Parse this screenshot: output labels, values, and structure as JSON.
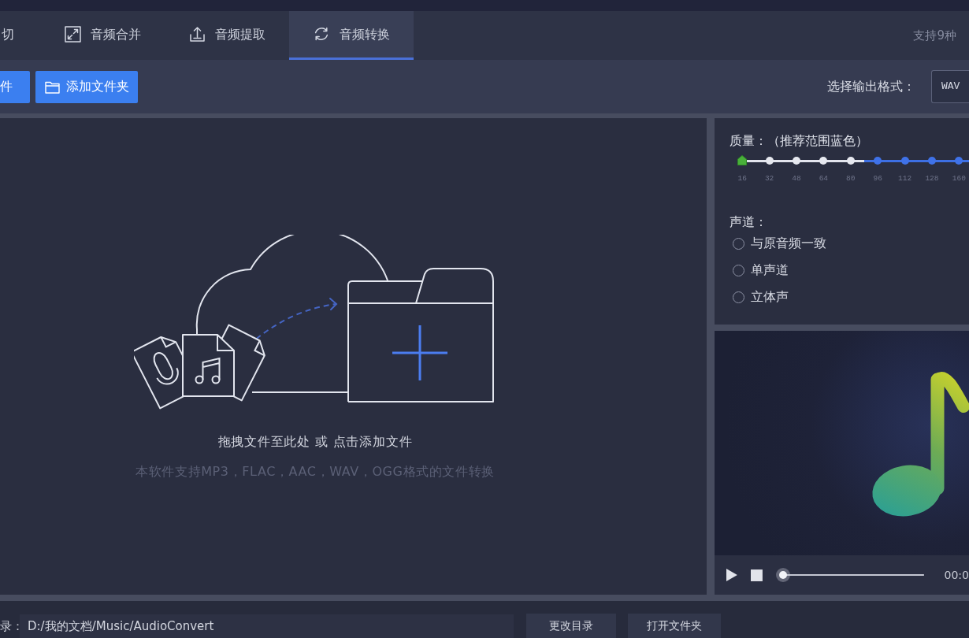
{
  "top_bar": {
    "note": "支持9种"
  },
  "tabs": [
    {
      "label": "切",
      "selected": false
    },
    {
      "label": "音频合并",
      "selected": false
    },
    {
      "label": "音频提取",
      "selected": false
    },
    {
      "label": "音频转换",
      "selected": true
    }
  ],
  "toolbar": {
    "buttons": [
      {
        "label": "件"
      },
      {
        "label": "添加文件夹"
      }
    ],
    "format_label": "选择输出格式：",
    "format_value": "WAV"
  },
  "drop_area": {
    "hint": "拖拽文件至此处 或 点击添加文件",
    "note": "本软件支持MP3，FLAC，AAC，WAV，OGG格式的文件转换"
  },
  "quality": {
    "label": "质量：（推荐范围蓝色）",
    "level": 0,
    "ticks": [
      {
        "label": "16",
        "recommended": false
      },
      {
        "label": "32",
        "recommended": false
      },
      {
        "label": "48",
        "recommended": false
      },
      {
        "label": "64",
        "recommended": false
      },
      {
        "label": "80",
        "recommended": false
      },
      {
        "label": "96",
        "recommended": true
      },
      {
        "label": "112",
        "recommended": true
      },
      {
        "label": "128",
        "recommended": true
      },
      {
        "label": "160",
        "recommended": true
      }
    ]
  },
  "channel": {
    "label": "声道：",
    "options": [
      {
        "label": "与原音频一致",
        "selected": false
      },
      {
        "label": "单声道",
        "selected": false
      },
      {
        "label": "立体声",
        "selected": false
      }
    ]
  },
  "player": {
    "level": 0,
    "time": "00:0"
  },
  "output": {
    "label": "录：",
    "path": "D:/我的文档/Music/AudioConvert",
    "buttons": [
      "更改目录",
      "打开文件夹"
    ]
  }
}
